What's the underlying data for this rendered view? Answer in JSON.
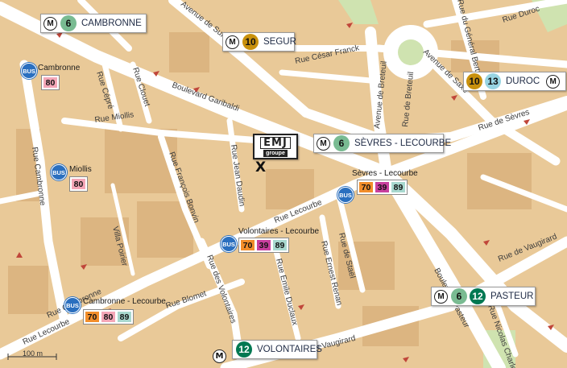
{
  "metro_stations": [
    {
      "id": "cambronne",
      "name": "CAMBRONNE",
      "lines": [
        "6"
      ]
    },
    {
      "id": "segur",
      "name": "SEGUR",
      "lines": [
        "10"
      ]
    },
    {
      "id": "duroc",
      "name": "DUROC",
      "lines": [
        "10",
        "13"
      ]
    },
    {
      "id": "sevres",
      "name": "SÈVRES - LECOURBE",
      "lines": [
        "6"
      ]
    },
    {
      "id": "pasteur",
      "name": "PASTEUR",
      "lines": [
        "6",
        "12"
      ]
    },
    {
      "id": "volontaires",
      "name": "VOLONTAIRES",
      "lines": [
        "12"
      ]
    }
  ],
  "metro_symbol": "M",
  "line_colors": {
    "6": "#79bb92",
    "10": "#c9910d",
    "12": "#007852",
    "13": "#98d4e2"
  },
  "bus_symbol": "BUS",
  "bus_stops": [
    {
      "id": "cambronne",
      "name": "Cambronne",
      "routes": [
        "80"
      ]
    },
    {
      "id": "miollis",
      "name": "Miollis",
      "routes": [
        "80"
      ]
    },
    {
      "id": "sevres",
      "name": "Sèvres - Lecourbe",
      "routes": [
        "70",
        "39",
        "89"
      ]
    },
    {
      "id": "volontaires",
      "name": "Volontaires - Lecourbe",
      "routes": [
        "70",
        "39",
        "89"
      ]
    },
    {
      "id": "cambronne-lecourbe",
      "name": "Cambronne - Lecourbe",
      "routes": [
        "70",
        "80",
        "89"
      ]
    }
  ],
  "route_colors": {
    "70": "#f28e2b",
    "80": "#f4a6b7",
    "39": "#c93f9e",
    "89": "#a8d8cf"
  },
  "streets": {
    "s1": "Avenue de Suffren",
    "s2": "Rue César Franck",
    "s3": "Boulevard Garibaldi",
    "s4": "Rue Cépré",
    "s5": "Rue Clouet",
    "s6": "Rue Miollis",
    "s7": "Rue Cambronne",
    "s8": "Rue François Bonvin",
    "s9": "Villa Poirier",
    "s10": "Rue Jean Daudin",
    "s11": "Rue Lecourbe",
    "s12": "Rue des Volontaires",
    "s13": "Rue Blomet",
    "s14": "Rue Emile Duclaux",
    "s15": "Rue Ernest Renan",
    "s16": "Rue de Staël",
    "s17": "Rue Lecourbe",
    "s18": "Rue Vaugirard",
    "s19": "Rue de Vaugirard",
    "s20": "Boulevard Pasteur",
    "s21": "Rue Nicolas Charlet",
    "s22": "Avenue de Breteuil",
    "s23": "Rue de Breteuil",
    "s24": "Avenue de Saxe",
    "s25": "Rue de Sèvres",
    "s26": "Rue de Sèvres",
    "s27": "Rue Duroc",
    "s28": "Rue du Général Bertrand",
    "s29": "Rue de Vaugirard",
    "s30": "Rue Cambronne"
  },
  "logo": {
    "mark": "EMJ",
    "sub": "groupe"
  },
  "marker": "X",
  "scale_label": "100 m"
}
